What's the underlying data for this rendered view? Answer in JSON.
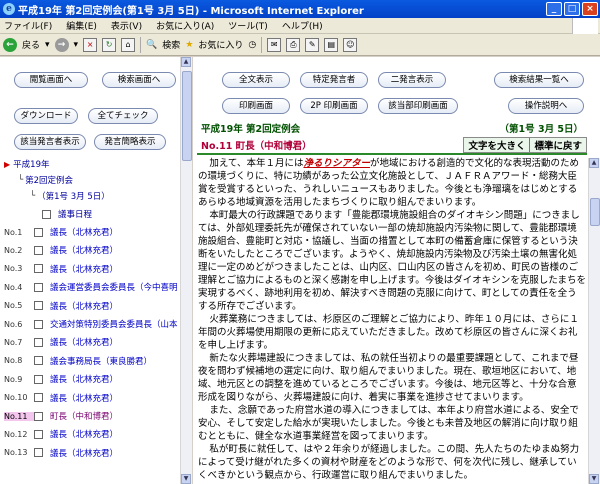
{
  "window": {
    "title": "平成19年 第2回定例会(第1号 3月 5日) - Microsoft Internet Explorer"
  },
  "menu": [
    "ファイル(F)",
    "編集(E)",
    "表示(V)",
    "お気に入り(A)",
    "ツール(T)",
    "ヘルプ(H)"
  ],
  "toolbar": {
    "back_label": "戻る",
    "search_label": "検索",
    "favorites_label": "お気に入り"
  },
  "left_buttons": {
    "browse": "閲覧画面へ",
    "search": "検索画面へ",
    "download": "ダウンロード",
    "check_all": "全てチェック",
    "speaker_display": "該当発言者表示",
    "speaker_list": "発言簡略表示"
  },
  "right_buttons": {
    "full_display": "全文表示",
    "specific_speaker": "特定発言者",
    "two_column": "二発言表示",
    "result_list": "検索結果一覧へ",
    "print_screen": "印刷画面",
    "print_2p": "2P 印刷画面",
    "print_speaker": "該当部印刷画面",
    "help": "操作説明へ"
  },
  "tree": {
    "root": "平成19年",
    "session": "第2回定例会",
    "meeting": "（第1号 3月 5日）",
    "agenda": "議事日程",
    "items": [
      {
        "num": "No.1",
        "text": "議長（北林充君）",
        "mid": false
      },
      {
        "num": "No.2",
        "text": "議長（北林充君）",
        "mid": false
      },
      {
        "num": "No.3",
        "text": "議長（北林充君）",
        "mid": false
      },
      {
        "num": "No.4",
        "text": "議会運営委員会委員長（今中喜明",
        "mid": false
      },
      {
        "num": "No.5",
        "text": "議長（北林充君）",
        "mid": false
      },
      {
        "num": "No.6",
        "text": "交通対策特別委員会委員長（山本",
        "mid": false
      },
      {
        "num": "No.7",
        "text": "議長（北林充君）",
        "mid": false
      },
      {
        "num": "No.8",
        "text": "議会事務局長（東良勝君）",
        "mid": false
      },
      {
        "num": "No.9",
        "text": "議長（北林充君）",
        "mid": false
      },
      {
        "num": "No.10",
        "text": "議長（北林充君）",
        "mid": false
      },
      {
        "num": "No.11",
        "text": "町長（中和博君）",
        "mid": true
      },
      {
        "num": "No.12",
        "text": "議長（北林充君）",
        "mid": false
      },
      {
        "num": "No.13",
        "text": "議長（北林充君）",
        "mid": false
      }
    ]
  },
  "content": {
    "meeting_title": "平成19年 第2回定例会",
    "meeting_date": "（第1号 3月 5日）",
    "speaker": "No.11 町長（中和博君）",
    "enlarge": "文字を大きく",
    "standard": "標準に戻す",
    "p1_before": "加えて、本年１月には",
    "p1_em": "浄るりシアター",
    "p1_after": "が地域における創造的で文化的な表現活動のための環境づくりに、特に功績があった公立文化施設として、ＪＡＦＲＡアワード・総務大臣賞を受賞するといった、うれしいニュースもありました。今後とも浄瑠璃をはじめとするあらゆる地域資源を活用したまちづくりに取り組んでまいります。",
    "p2": "本町最大の行政課題であります「豊能郡環境施設組合のダイオキシン問題」につきましては、外部処理委託先が確保されていない一部の焼却施設内汚染物に関して、豊能郡環境施設組合、豊能町と対応・協議し、当面の措置として本町の備蓄倉庫に保管するという決断をいたしたところでございます。ようやく、焼却施設内汚染物及び汚染土壌の無害化処理に一定のめどがつきましたことは、山内区、口山内区の皆さんを初め、町民の皆様のご理解とご協力によるものと深く感謝を申し上げます。今後はダイオキシンを克服したまちを実現するべく、跡地利用を初め、解決すべき問題の克服に向けて、町としての責任を全うする所存でございます。",
    "p3": "火葬業務につきましては、杉原区のご理解とご協力により、昨年１０月には、さらに１年間の火葬場使用期限の更新に応えていただきました。改めて杉原区の皆さんに深くお礼を申し上げます。",
    "p4": "新たな火葬場建設につきましては、私の就任当初よりの最重要課題として、これまで昼夜を問わず候補地の選定に向け、取り組んでまいりました。現在、歌垣地区において、地域、地元区との調整を進めているところでございます。今後は、地元区等と、十分な合意形成を図りながら、火葬場建設に向け、着実に事業を進捗させてまいります。",
    "p5": "また、念願であった府営水道の導入につきましては、本年より府営水道による、安全で安心、そして安定した給水が実現いたしました。今後とも未普及地区の解消に向け取り組むとともに、健全な水道事業経営を図ってまいります。",
    "p6": "私が町長に就任して、はや２年余りが経過しました。この間、先人たちのたゆまぬ努力によって受け継がれた多くの資材や財産をどのような形で、何を次代に残し、継承していくべきかという観点から、行政運営に取り組んでまいりました。"
  }
}
